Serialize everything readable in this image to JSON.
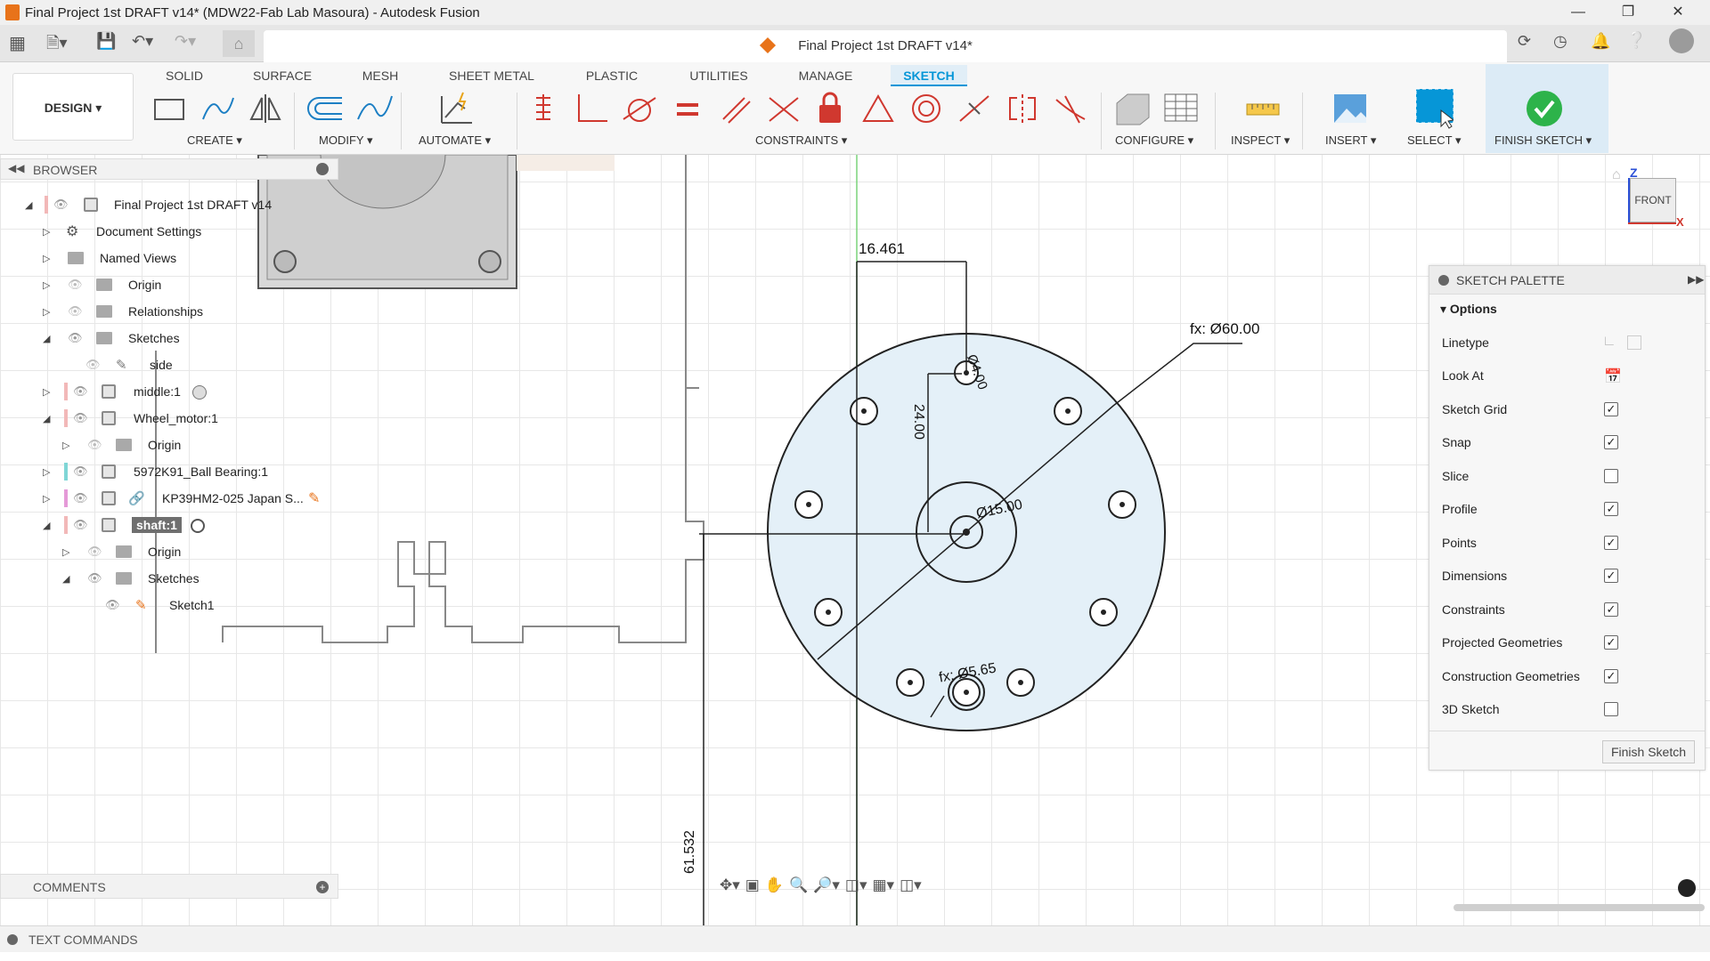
{
  "window": {
    "title": "Final Project 1st DRAFT v14* (MDW22-Fab Lab Masoura) - Autodesk Fusion"
  },
  "document_tab": {
    "title": "Final Project 1st DRAFT v14*"
  },
  "workspace_tabs": [
    "SOLID",
    "SURFACE",
    "MESH",
    "SHEET METAL",
    "PLASTIC",
    "UTILITIES",
    "MANAGE",
    "SKETCH"
  ],
  "design_button": "DESIGN",
  "tool_groups": {
    "create": "CREATE",
    "modify": "MODIFY",
    "automate": "AUTOMATE",
    "constraints": "CONSTRAINTS",
    "configure": "CONFIGURE",
    "inspect": "INSPECT",
    "insert": "INSERT",
    "select": "SELECT",
    "finish_sketch": "FINISH SKETCH"
  },
  "browser": {
    "header": "BROWSER",
    "items": [
      {
        "label": "Final Project 1st DRAFT v14"
      },
      {
        "label": "Document Settings"
      },
      {
        "label": "Named Views"
      },
      {
        "label": "Origin"
      },
      {
        "label": "Relationships"
      },
      {
        "label": "Sketches"
      },
      {
        "label": "side"
      },
      {
        "label": "middle:1"
      },
      {
        "label": "Wheel_motor:1"
      },
      {
        "label": "Origin"
      },
      {
        "label": "5972K91_Ball Bearing:1"
      },
      {
        "label": "KP39HM2-025 Japan S..."
      },
      {
        "label": "shaft:1"
      },
      {
        "label": "Origin"
      },
      {
        "label": "Sketches"
      },
      {
        "label": "Sketch1"
      }
    ]
  },
  "comments": {
    "header": "COMMENTS"
  },
  "text_commands": {
    "header": "TEXT COMMANDS"
  },
  "viewcube": {
    "face": "FRONT",
    "axis_z": "Z",
    "axis_x": "X"
  },
  "sketch_palette": {
    "header": "SKETCH PALETTE",
    "section": "Options",
    "options": [
      {
        "label": "Linetype",
        "type": "icons"
      },
      {
        "label": "Look At",
        "type": "icon"
      },
      {
        "label": "Sketch Grid",
        "checked": true
      },
      {
        "label": "Snap",
        "checked": true
      },
      {
        "label": "Slice",
        "checked": false
      },
      {
        "label": "Profile",
        "checked": true
      },
      {
        "label": "Points",
        "checked": true
      },
      {
        "label": "Dimensions",
        "checked": true
      },
      {
        "label": "Constraints",
        "checked": true
      },
      {
        "label": "Projected Geometries",
        "checked": true
      },
      {
        "label": "Construction Geometries",
        "checked": true
      },
      {
        "label": "3D Sketch",
        "checked": false
      }
    ],
    "finish_button": "Finish Sketch"
  },
  "dimensions": {
    "d1": "16.461",
    "d2": "fx: Ø60.00",
    "d3": "24.00",
    "d4": "Ø4.00",
    "d5": "Ø15.00",
    "d6": "fx: Ø5.65",
    "d7": "61.532"
  },
  "colors": {
    "accent": "#0696d7",
    "sketch_fill": "#e4f0f8",
    "finish_green": "#2db34a"
  }
}
